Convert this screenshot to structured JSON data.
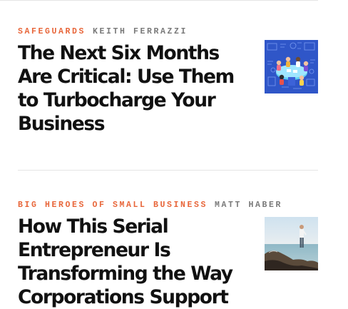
{
  "articles": [
    {
      "category": "SAFEGUARDS",
      "author": "KEITH FERRAZZI",
      "headline": "The Next Six Months Are Critical: Use Them to Turbocharge Your Business",
      "thumbnail_icon": "team-meeting-illustration-icon"
    },
    {
      "category": "BIG HEROES OF SMALL BUSINESS",
      "author": "MATT HABER",
      "headline": "How This Serial Entrepreneur Is Transforming the Way Corporations Support",
      "thumbnail_icon": "man-on-rocks-photo-icon"
    }
  ],
  "colors": {
    "category": "#e8663a",
    "author": "#7a7a7a",
    "headline": "#111111",
    "divider": "#e4e4e4"
  }
}
